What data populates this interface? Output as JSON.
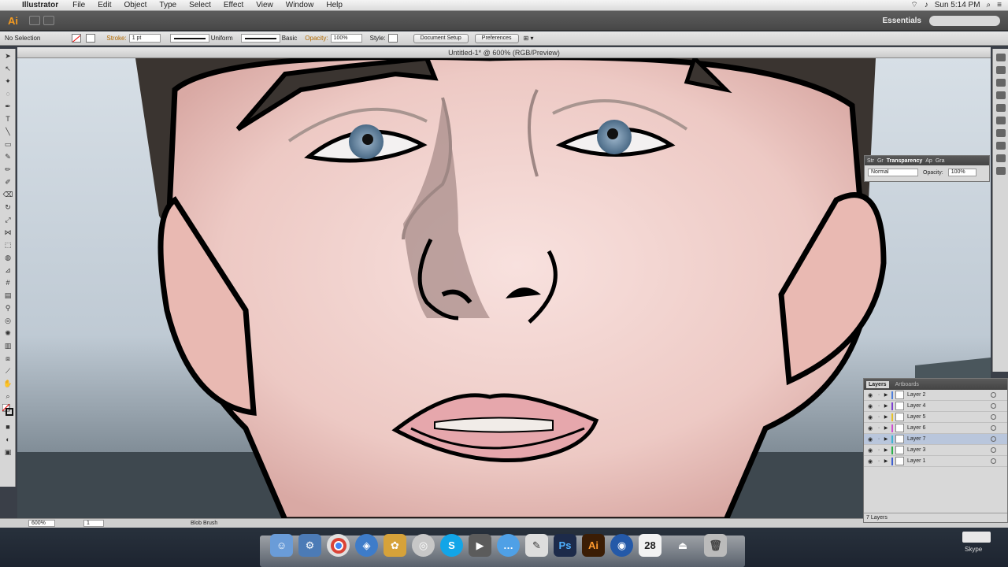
{
  "menubar": {
    "app_name": "Illustrator",
    "items": [
      "File",
      "Edit",
      "Object",
      "Type",
      "Select",
      "Effect",
      "View",
      "Window",
      "Help"
    ],
    "clock": "Sun 5:14 PM"
  },
  "appbar": {
    "logo": "Ai",
    "workspace": "Essentials"
  },
  "controlbar": {
    "selection": "No Selection",
    "stroke_label": "Stroke:",
    "stroke_weight": "1 pt",
    "profile": "Uniform",
    "brush": "Basic",
    "opacity_label": "Opacity:",
    "opacity_value": "100%",
    "style_label": "Style:",
    "document_setup": "Document Setup",
    "preferences": "Preferences"
  },
  "document": {
    "title": "Untitled-1* @ 600% (RGB/Preview)"
  },
  "statusbar": {
    "zoom": "600%",
    "artboard": "1",
    "tool": "Blob Brush"
  },
  "transparency": {
    "tabs": [
      "Str",
      "Gr",
      "Transparency",
      "Ap",
      "Gra"
    ],
    "blend_mode": "Normal",
    "opacity_label": "Opacity:",
    "opacity_value": "100%"
  },
  "layers": {
    "tabs": [
      "Layers",
      "Artboards"
    ],
    "items": [
      {
        "name": "Layer 2",
        "color": "#4f7fdc"
      },
      {
        "name": "Layer 4",
        "color": "#7e3fd1"
      },
      {
        "name": "Layer 5",
        "color": "#e6c22b"
      },
      {
        "name": "Layer 6",
        "color": "#d14fd1"
      },
      {
        "name": "Layer 7",
        "color": "#3fb4d1"
      },
      {
        "name": "Layer 3",
        "color": "#2bb24a"
      },
      {
        "name": "Layer 1",
        "color": "#3f5fd1"
      }
    ],
    "count": "7 Layers",
    "selected_index": 4
  },
  "dock": {
    "skype_label": "Skype",
    "calendar_day": "28",
    "ps_label": "Ps",
    "ai_label": "Ai",
    "icons": [
      "finder-icon",
      "network-icon",
      "chrome-icon",
      "safari-icon",
      "pineapple-icon",
      "chat-icon",
      "skype-icon",
      "video-icon",
      "messages-icon",
      "draw-icon",
      "photoshop-icon",
      "illustrator-icon",
      "globe-icon",
      "calendar-icon",
      "eject-icon",
      "trash-icon"
    ]
  }
}
